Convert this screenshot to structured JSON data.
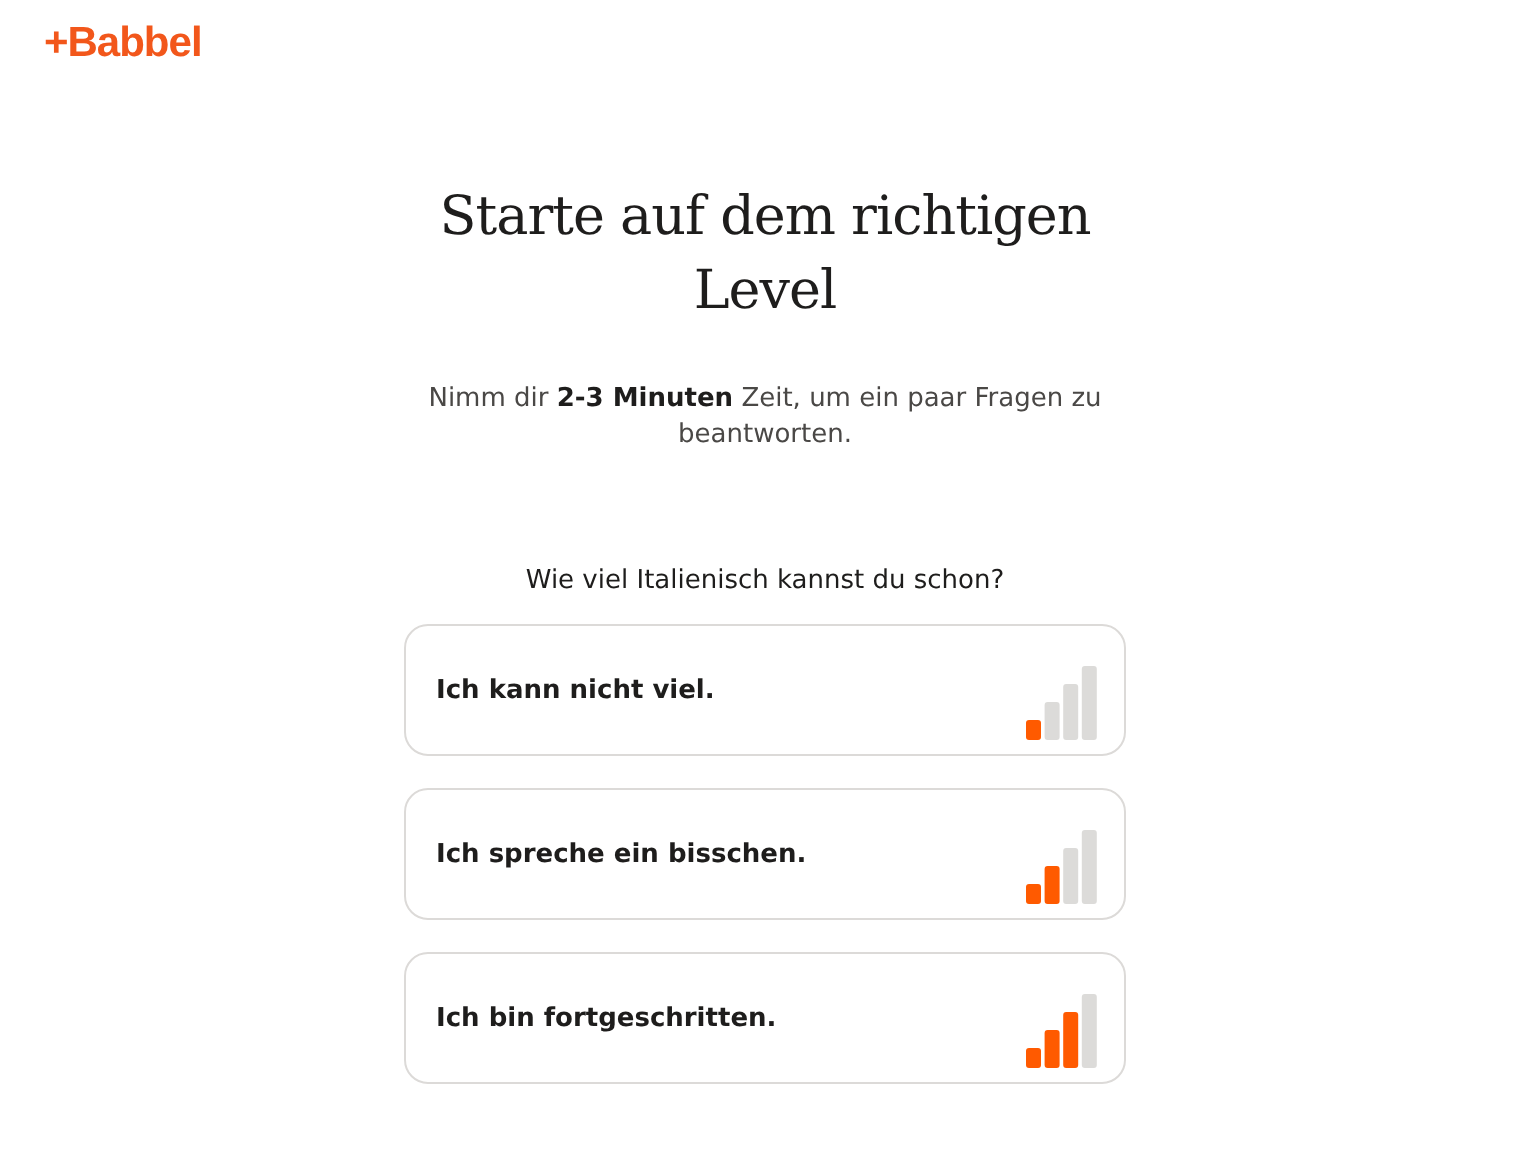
{
  "logo": {
    "text": "+Babbel"
  },
  "heading": "Starte auf dem richtigen Level",
  "intro": "Nimm dir **2-3 Minuten** Zeit, um ein paar Fragen zu beantworten.",
  "question": "Wie viel Italienisch kannst du schon?",
  "options": [
    {
      "label": "Ich kann nicht viel.",
      "level": 0.25
    },
    {
      "label": "Ich spreche ein bisschen.",
      "level": 0.5
    },
    {
      "label": "Ich bin fortgeschritten.",
      "level": 0.75
    }
  ]
}
